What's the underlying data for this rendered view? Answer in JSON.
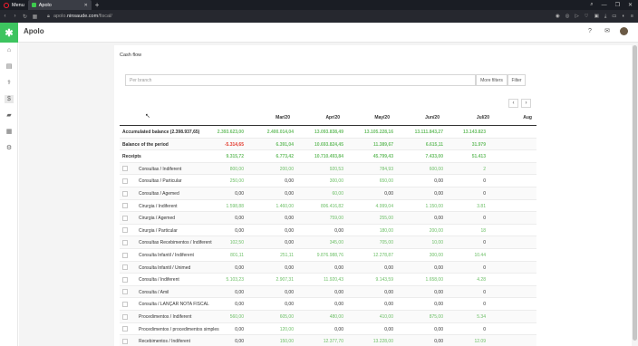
{
  "browser": {
    "menu_label": "Menu",
    "tab_title": "Apolo",
    "url_prefix": "apolo.",
    "url_domain": "ninsaude.com",
    "url_path": "/fiscal/"
  },
  "app": {
    "name": "Apolo"
  },
  "page": {
    "title": "Cash flow",
    "search_placeholder": "Per branch",
    "more_filters_label": "More filters",
    "filter_label": "Filter",
    "prev_label": "‹",
    "next_label": "›"
  },
  "table": {
    "columns": [
      "Mar/20",
      "Apr/20",
      "May/20",
      "Jun/20",
      "Jul/20",
      "Aug"
    ],
    "accumulated": {
      "label": "Accumulated balance (2.398.937,65)",
      "values": [
        "2.393.623,00",
        "2.400.014,04",
        "13.093.838,49",
        "13.105.228,16",
        "13.111.843,27",
        "13.143.823"
      ]
    },
    "period": {
      "label": "Balance of the period",
      "values": [
        "-5.314,65",
        "6.391,04",
        "10.693.824,45",
        "11.389,67",
        "6.615,11",
        "31.979"
      ]
    },
    "receipts": {
      "label": "Receipts",
      "values": [
        "9.315,72",
        "6.773,42",
        "10.710.493,84",
        "45.799,43",
        "7.433,00",
        "51.413"
      ]
    },
    "rows": [
      {
        "label": "Consultas / Indiferent",
        "values": [
          "800,00",
          "200,00",
          "920,53",
          "784,93",
          "600,00",
          "2"
        ]
      },
      {
        "label": "Consultas / Particular",
        "values": [
          "250,00",
          "0,00",
          "300,00",
          "650,00",
          "0,00",
          "0"
        ]
      },
      {
        "label": "Consultas / Agemed",
        "values": [
          "0,00",
          "0,00",
          "60,00",
          "0,00",
          "0,00",
          "0"
        ]
      },
      {
        "label": "Cirurgia / Indiferent",
        "values": [
          "1.598,88",
          "1.460,00",
          "806.416,82",
          "4.999,04",
          "1.150,00",
          "3.81"
        ]
      },
      {
        "label": "Cirurgia / Agemed",
        "values": [
          "0,00",
          "0,00",
          "759,00",
          "255,00",
          "0,00",
          "0"
        ]
      },
      {
        "label": "Cirurgia / Particular",
        "values": [
          "0,00",
          "0,00",
          "0,00",
          "180,00",
          "200,00",
          "18"
        ]
      },
      {
        "label": "Consultas Recebimentos / Indiferent",
        "values": [
          "102,50",
          "0,00",
          "345,00",
          "705,00",
          "10,00",
          "0"
        ]
      },
      {
        "label": "Consulta Infantil / Indiferent",
        "values": [
          "801,11",
          "251,11",
          "9.876.988,76",
          "12.278,87",
          "300,00",
          "10.44"
        ]
      },
      {
        "label": "Consulta Infantil / Unimed",
        "values": [
          "0,00",
          "0,00",
          "0,00",
          "0,00",
          "0,00",
          "0"
        ]
      },
      {
        "label": "Consulta / Indiferent",
        "values": [
          "5.103,23",
          "2.907,31",
          "11.920,43",
          "9.143,59",
          "1.658,00",
          "4.28"
        ]
      },
      {
        "label": "Consulta / Amil",
        "values": [
          "0,00",
          "0,00",
          "0,00",
          "0,00",
          "0,00",
          "0"
        ]
      },
      {
        "label": "Consulta / LANÇAR NOTA FISCAL",
        "values": [
          "0,00",
          "0,00",
          "0,00",
          "0,00",
          "0,00",
          "0"
        ]
      },
      {
        "label": "Procedimentos / Indiferent",
        "values": [
          "560,00",
          "605,00",
          "480,00",
          "410,00",
          "875,00",
          "5.34"
        ]
      },
      {
        "label": "Procedimentos / procedimentos simples",
        "values": [
          "0,00",
          "120,00",
          "0,00",
          "0,00",
          "0,00",
          "0"
        ]
      },
      {
        "label": "Recebimentos / Indiferent",
        "values": [
          "0,00",
          "150,00",
          "12.377,70",
          "13.228,00",
          "0,00",
          "12.09"
        ]
      }
    ]
  },
  "colors": {
    "positive": "#6cbf66",
    "negative": "#e33b2e",
    "brand": "#3dc45f"
  }
}
